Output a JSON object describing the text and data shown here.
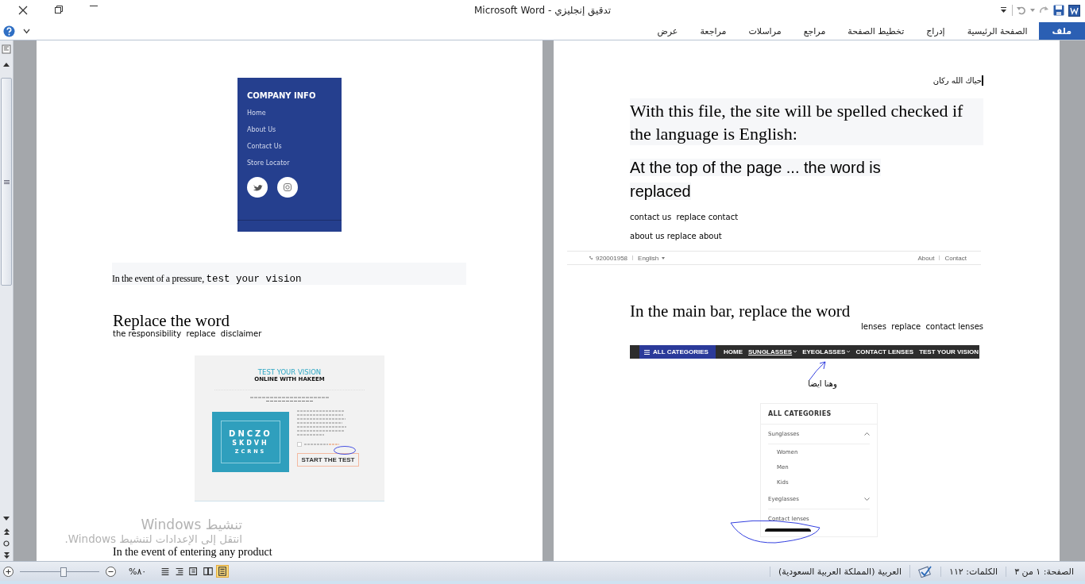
{
  "window": {
    "title": "تدقيق إنجليزي - Microsoft Word"
  },
  "ribbon": {
    "tabs": [
      {
        "label": "ملف",
        "kind": "file"
      },
      {
        "label": "الصفحة الرئيسية",
        "kind": "tab"
      },
      {
        "label": "إدراج",
        "kind": "tab"
      },
      {
        "label": "تخطيط الصفحة",
        "kind": "tab"
      },
      {
        "label": "مراجع",
        "kind": "tab"
      },
      {
        "label": "مراسلات",
        "kind": "tab"
      },
      {
        "label": "مراجعة",
        "kind": "tab"
      },
      {
        "label": "عرض",
        "kind": "tab"
      }
    ]
  },
  "document": {
    "pages": [
      {
        "blocks": [
          {
            "kind": "footer-shot",
            "title": "COMPANY INFO",
            "links": [
              "Home",
              "About Us",
              "Contact Us",
              "Store Locator"
            ]
          },
          {
            "kind": "shaded-para",
            "text": "In the event of a pressure,",
            "code": "test your vision"
          },
          {
            "kind": "heading",
            "text": "Replace the word"
          },
          {
            "kind": "note",
            "text": "the responsibility  replace  disclaimer"
          },
          {
            "kind": "vision-shot",
            "title": "TEST YOUR VISION",
            "subtitle": "ONLINE WITH HAKEEM",
            "chart_lines": [
              "DNCZO",
              "SKDVH",
              "ZCRNS"
            ],
            "consent": {
              "checked": false
            },
            "button": "START THE TEST"
          },
          {
            "kind": "para",
            "text": "In the event of entering any product"
          }
        ],
        "overlay": {
          "title": "تنشيط Windows",
          "hint": "انتقل إلى الإعدادات لتنشيط Windows."
        }
      },
      {
        "blocks": [
          {
            "kind": "greeting",
            "text": "حياك الله ركان"
          },
          {
            "kind": "shaded-serif",
            "text": "With this file, the site will be spelled checked if the language is English:"
          },
          {
            "kind": "shaded-sans",
            "text": "At the top of the page ... the word is replaced"
          },
          {
            "kind": "note",
            "text": "contact us  replace contact"
          },
          {
            "kind": "note",
            "text": "about us replace about"
          },
          {
            "kind": "topbar-shot",
            "phone": "920001958",
            "language": "English",
            "links": [
              "About",
              "Contact"
            ]
          },
          {
            "kind": "heading",
            "text": "In the main bar, replace the word"
          },
          {
            "kind": "note-right",
            "text": "lenses  replace  contact lenses"
          },
          {
            "kind": "navbar-shot",
            "menu": "ALL CATEGORIES",
            "items": [
              {
                "label": "HOME",
                "selected": false,
                "dropdown": false
              },
              {
                "label": "SUNGLASSES",
                "selected": true,
                "dropdown": true
              },
              {
                "label": "EYEGLASSES",
                "selected": false,
                "dropdown": true
              },
              {
                "label": "CONTACT LENSES",
                "selected": false,
                "dropdown": false
              },
              {
                "label": "TEST YOUR VISION",
                "selected": false,
                "dropdown": false
              }
            ]
          },
          {
            "kind": "arabic-note",
            "text": "وهنا ايضا"
          },
          {
            "kind": "categories-shot",
            "title": "ALL CATEGORIES",
            "groups": [
              {
                "label": "Sunglasses",
                "expanded": true,
                "children": [
                  {
                    "label": "Women"
                  },
                  {
                    "label": "Men"
                  },
                  {
                    "label": "Kids"
                  }
                ]
              },
              {
                "label": "Eyeglasses",
                "expanded": false
              },
              {
                "label": "Contact lenses"
              }
            ]
          }
        ]
      }
    ]
  },
  "status_bar": {
    "page": "الصفحة: ١ من ٣",
    "words": "الكلمات: ١١٢",
    "language": "العربية (المملكة العربية السعودية)",
    "zoom": "%٨٠",
    "zoom_slider": {
      "level": 0.55
    },
    "views": [
      {
        "kind": "draft",
        "selected": false
      },
      {
        "kind": "outline",
        "selected": false
      },
      {
        "kind": "web",
        "selected": false
      },
      {
        "kind": "reading",
        "selected": false
      },
      {
        "kind": "print",
        "selected": true
      }
    ]
  }
}
